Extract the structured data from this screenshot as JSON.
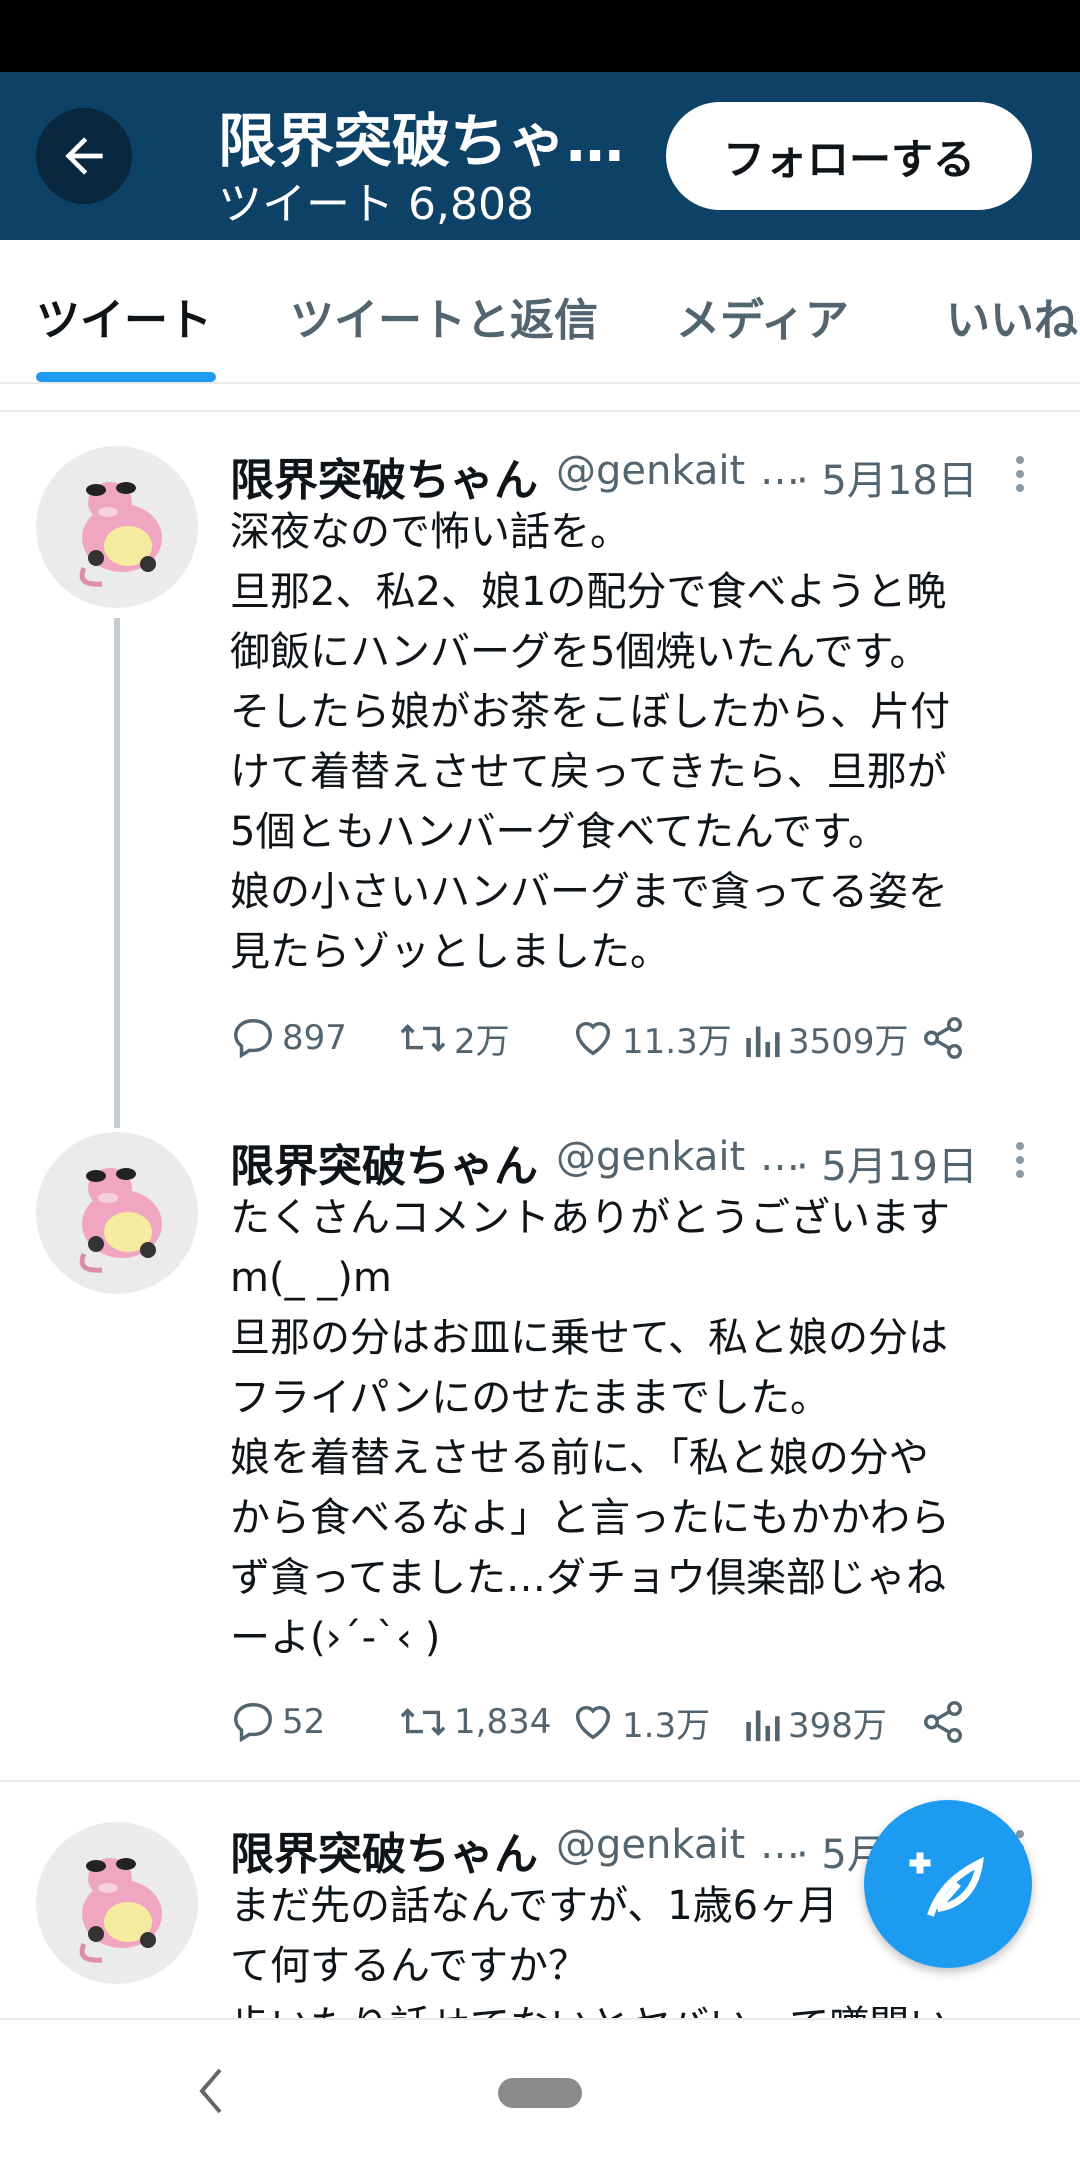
{
  "header": {
    "title": "限界突破ちゃ…",
    "subtitle": "ツイート 6,808",
    "follow_label": "フォローする"
  },
  "tabs": [
    {
      "label": "ツイート"
    },
    {
      "label": "ツイートと返信"
    },
    {
      "label": "メディア"
    },
    {
      "label": "いいね"
    }
  ],
  "tweets": [
    {
      "name": "限界突破ちゃん",
      "handle": "@genkait",
      "ellipsis": "…",
      "date": "· 5月18日",
      "body": "深夜なので怖い話を。\n旦那2、私2、娘1の配分で食べようと晩\n御飯にハンバーグを5個焼いたんです。\nそしたら娘がお茶をこぼしたから、片付\nけて着替えさせて戻ってきたら、旦那が\n5個ともハンバーグ食べてたんです。\n娘の小さいハンバーグまで貪ってる姿を\n見たらゾッとしました。",
      "replies": "897",
      "retweets": "2万",
      "likes": "11.3万",
      "views": "3509万"
    },
    {
      "name": "限界突破ちゃん",
      "handle": "@genkait",
      "ellipsis": "…",
      "date": "· 5月19日",
      "body": "たくさんコメントありがとうございます\nm(_ _)m\n旦那の分はお皿に乗せて、私と娘の分は\nフライパンにのせたままでした。\n娘を着替えさせる前に、「私と娘の分や\nから食べるなよ」と言ったにもかかわら\nず貪ってました…ダチョウ倶楽部じゃね\nーよ(›´-`‹ )",
      "replies": "52",
      "retweets": "1,834",
      "likes": "1.3万",
      "views": "398万"
    },
    {
      "name": "限界突破ちゃん",
      "handle": "@genkait",
      "ellipsis": "…",
      "date": "· 5月",
      "body": "まだ先の話なんですが、1歳6ヶ月\nて何するんですか？\n歩いたり話せてないとヤバい、て噂聞い"
    }
  ],
  "colors": {
    "header_bg": "#0e4166",
    "accent": "#1d9bf0",
    "text_secondary": "#536471"
  },
  "icons": {
    "back": "arrow-left-icon",
    "reply": "speech-bubble-icon",
    "retweet": "retweet-icon",
    "like": "heart-icon",
    "views": "bar-chart-icon",
    "share": "share-icon",
    "compose": "feather-plus-icon"
  }
}
